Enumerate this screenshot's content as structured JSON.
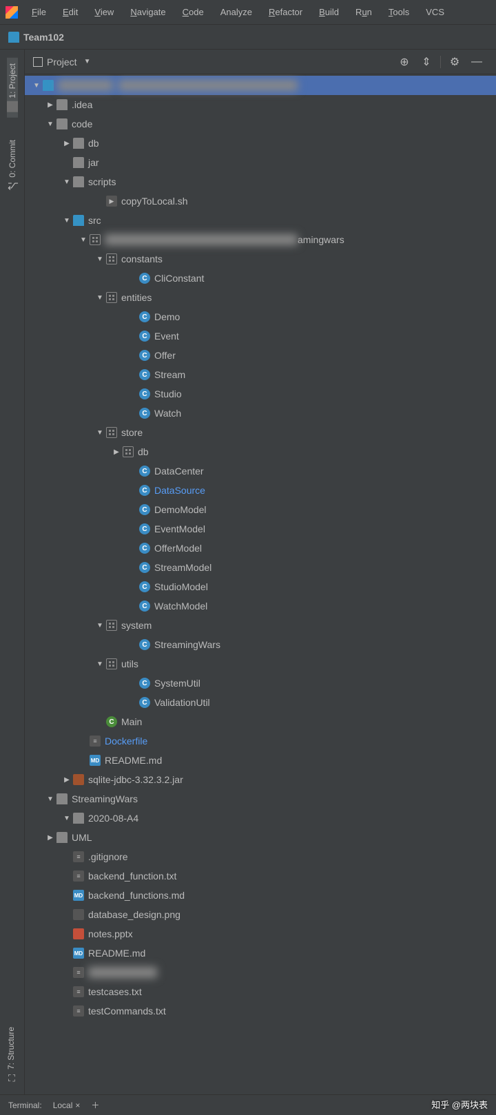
{
  "menu": {
    "file": "File",
    "edit": "Edit",
    "view": "View",
    "navigate": "Navigate",
    "code": "Code",
    "analyze": "Analyze",
    "refactor": "Refactor",
    "build": "Build",
    "run": "Run",
    "tools": "Tools",
    "vcs": "VCS"
  },
  "breadcrumb": {
    "project": "Team102"
  },
  "leftSidebar": {
    "project": "1: Project",
    "commit": "0: Commit",
    "structure": "7: Structure"
  },
  "panel": {
    "title": "Project"
  },
  "tree": {
    "root_blurred": "Team102",
    "root_path": "C:\\Users\\...\\GitHub\\...",
    "idea": ".idea",
    "code": "code",
    "db": "db",
    "jar": "jar",
    "scripts": "scripts",
    "copyToLocal": "copyToLocal.sh",
    "src": "src",
    "pkg_blurred": "edu.",
    "pkg_suffix": "amingwars",
    "constants": "constants",
    "cliConstant": "CliConstant",
    "entities": "entities",
    "demo": "Demo",
    "event": "Event",
    "offer": "Offer",
    "stream": "Stream",
    "studio": "Studio",
    "watch": "Watch",
    "store": "store",
    "store_db": "db",
    "dataCenter": "DataCenter",
    "dataSource": "DataSource",
    "demoModel": "DemoModel",
    "eventModel": "EventModel",
    "offerModel": "OfferModel",
    "streamModel": "StreamModel",
    "studioModel": "StudioModel",
    "watchModel": "WatchModel",
    "system": "system",
    "streamingWars": "StreamingWars",
    "utils": "utils",
    "systemUtil": "SystemUtil",
    "validationUtil": "ValidationUtil",
    "main": "Main",
    "dockerfile": "Dockerfile",
    "readme": "README.md",
    "sqliteJar": "sqlite-jdbc-3.32.3.2.jar",
    "streamingWarsDir": "StreamingWars",
    "dateDir": "2020-08-A4",
    "uml": "UML",
    "gitignore": ".gitignore",
    "backendFn": "backend_function.txt",
    "backendFns": "backend_functions.md",
    "dbDesign": "database_design.png",
    "notes": "notes.pptx",
    "readme2": "README.md",
    "testcases": "testcases.txt",
    "testCommands": "testCommands.txt"
  },
  "bottom": {
    "terminal": "Terminal:",
    "local": "Local"
  },
  "watermark": "知乎 @两块表"
}
